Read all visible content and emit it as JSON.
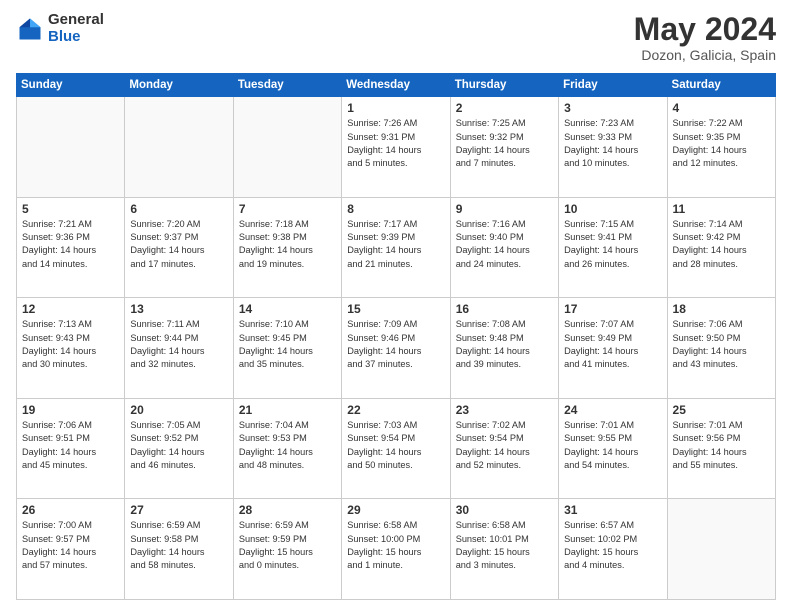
{
  "header": {
    "logo_general": "General",
    "logo_blue": "Blue",
    "main_title": "May 2024",
    "subtitle": "Dozon, Galicia, Spain"
  },
  "days_of_week": [
    "Sunday",
    "Monday",
    "Tuesday",
    "Wednesday",
    "Thursday",
    "Friday",
    "Saturday"
  ],
  "weeks": [
    [
      {
        "day": "",
        "info": ""
      },
      {
        "day": "",
        "info": ""
      },
      {
        "day": "",
        "info": ""
      },
      {
        "day": "1",
        "info": "Sunrise: 7:26 AM\nSunset: 9:31 PM\nDaylight: 14 hours\nand 5 minutes."
      },
      {
        "day": "2",
        "info": "Sunrise: 7:25 AM\nSunset: 9:32 PM\nDaylight: 14 hours\nand 7 minutes."
      },
      {
        "day": "3",
        "info": "Sunrise: 7:23 AM\nSunset: 9:33 PM\nDaylight: 14 hours\nand 10 minutes."
      },
      {
        "day": "4",
        "info": "Sunrise: 7:22 AM\nSunset: 9:35 PM\nDaylight: 14 hours\nand 12 minutes."
      }
    ],
    [
      {
        "day": "5",
        "info": "Sunrise: 7:21 AM\nSunset: 9:36 PM\nDaylight: 14 hours\nand 14 minutes."
      },
      {
        "day": "6",
        "info": "Sunrise: 7:20 AM\nSunset: 9:37 PM\nDaylight: 14 hours\nand 17 minutes."
      },
      {
        "day": "7",
        "info": "Sunrise: 7:18 AM\nSunset: 9:38 PM\nDaylight: 14 hours\nand 19 minutes."
      },
      {
        "day": "8",
        "info": "Sunrise: 7:17 AM\nSunset: 9:39 PM\nDaylight: 14 hours\nand 21 minutes."
      },
      {
        "day": "9",
        "info": "Sunrise: 7:16 AM\nSunset: 9:40 PM\nDaylight: 14 hours\nand 24 minutes."
      },
      {
        "day": "10",
        "info": "Sunrise: 7:15 AM\nSunset: 9:41 PM\nDaylight: 14 hours\nand 26 minutes."
      },
      {
        "day": "11",
        "info": "Sunrise: 7:14 AM\nSunset: 9:42 PM\nDaylight: 14 hours\nand 28 minutes."
      }
    ],
    [
      {
        "day": "12",
        "info": "Sunrise: 7:13 AM\nSunset: 9:43 PM\nDaylight: 14 hours\nand 30 minutes."
      },
      {
        "day": "13",
        "info": "Sunrise: 7:11 AM\nSunset: 9:44 PM\nDaylight: 14 hours\nand 32 minutes."
      },
      {
        "day": "14",
        "info": "Sunrise: 7:10 AM\nSunset: 9:45 PM\nDaylight: 14 hours\nand 35 minutes."
      },
      {
        "day": "15",
        "info": "Sunrise: 7:09 AM\nSunset: 9:46 PM\nDaylight: 14 hours\nand 37 minutes."
      },
      {
        "day": "16",
        "info": "Sunrise: 7:08 AM\nSunset: 9:48 PM\nDaylight: 14 hours\nand 39 minutes."
      },
      {
        "day": "17",
        "info": "Sunrise: 7:07 AM\nSunset: 9:49 PM\nDaylight: 14 hours\nand 41 minutes."
      },
      {
        "day": "18",
        "info": "Sunrise: 7:06 AM\nSunset: 9:50 PM\nDaylight: 14 hours\nand 43 minutes."
      }
    ],
    [
      {
        "day": "19",
        "info": "Sunrise: 7:06 AM\nSunset: 9:51 PM\nDaylight: 14 hours\nand 45 minutes."
      },
      {
        "day": "20",
        "info": "Sunrise: 7:05 AM\nSunset: 9:52 PM\nDaylight: 14 hours\nand 46 minutes."
      },
      {
        "day": "21",
        "info": "Sunrise: 7:04 AM\nSunset: 9:53 PM\nDaylight: 14 hours\nand 48 minutes."
      },
      {
        "day": "22",
        "info": "Sunrise: 7:03 AM\nSunset: 9:54 PM\nDaylight: 14 hours\nand 50 minutes."
      },
      {
        "day": "23",
        "info": "Sunrise: 7:02 AM\nSunset: 9:54 PM\nDaylight: 14 hours\nand 52 minutes."
      },
      {
        "day": "24",
        "info": "Sunrise: 7:01 AM\nSunset: 9:55 PM\nDaylight: 14 hours\nand 54 minutes."
      },
      {
        "day": "25",
        "info": "Sunrise: 7:01 AM\nSunset: 9:56 PM\nDaylight: 14 hours\nand 55 minutes."
      }
    ],
    [
      {
        "day": "26",
        "info": "Sunrise: 7:00 AM\nSunset: 9:57 PM\nDaylight: 14 hours\nand 57 minutes."
      },
      {
        "day": "27",
        "info": "Sunrise: 6:59 AM\nSunset: 9:58 PM\nDaylight: 14 hours\nand 58 minutes."
      },
      {
        "day": "28",
        "info": "Sunrise: 6:59 AM\nSunset: 9:59 PM\nDaylight: 15 hours\nand 0 minutes."
      },
      {
        "day": "29",
        "info": "Sunrise: 6:58 AM\nSunset: 10:00 PM\nDaylight: 15 hours\nand 1 minute."
      },
      {
        "day": "30",
        "info": "Sunrise: 6:58 AM\nSunset: 10:01 PM\nDaylight: 15 hours\nand 3 minutes."
      },
      {
        "day": "31",
        "info": "Sunrise: 6:57 AM\nSunset: 10:02 PM\nDaylight: 15 hours\nand 4 minutes."
      },
      {
        "day": "",
        "info": ""
      }
    ]
  ]
}
